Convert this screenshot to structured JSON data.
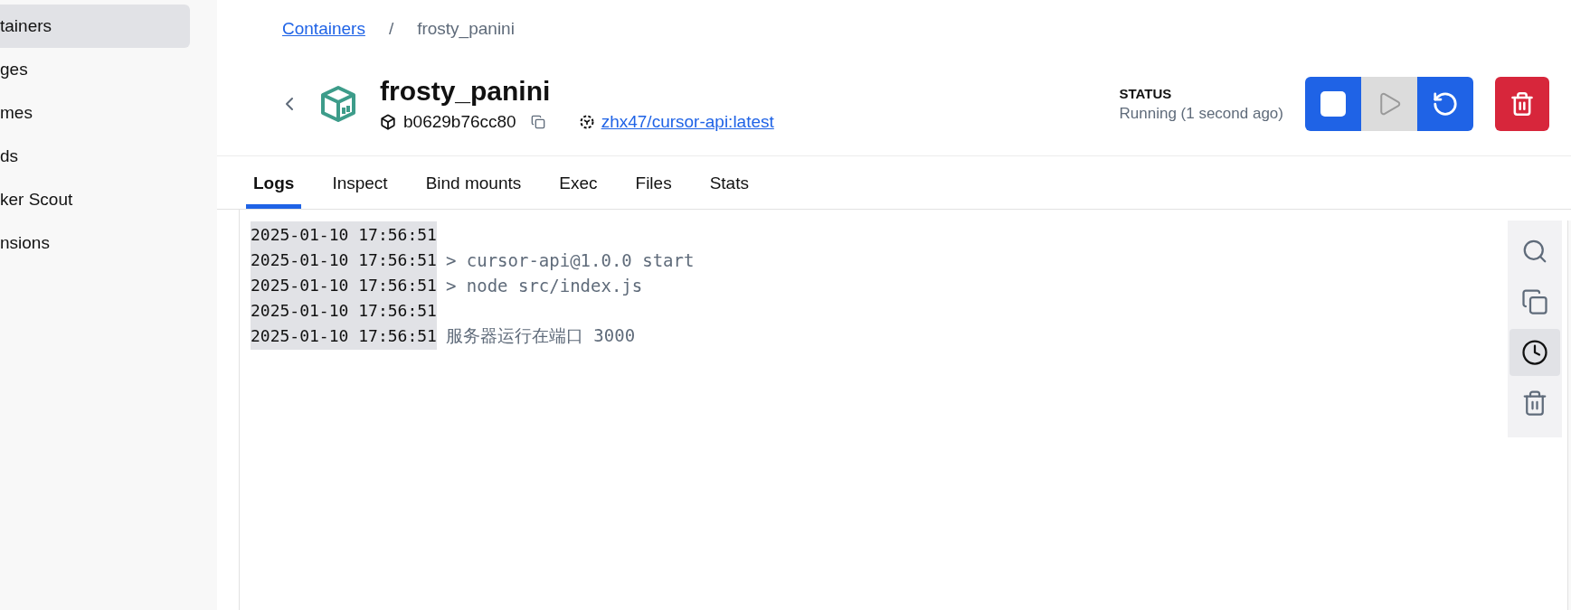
{
  "sidebar": {
    "items": [
      {
        "label": "tainers",
        "selected": true
      },
      {
        "label": "ges",
        "selected": false
      },
      {
        "label": "mes",
        "selected": false
      },
      {
        "label": "ds",
        "selected": false
      },
      {
        "label": "ker Scout",
        "selected": false
      },
      {
        "label": "nsions",
        "selected": false
      }
    ]
  },
  "breadcrumb": {
    "link": "Containers",
    "separator": "/",
    "current": "frosty_panini"
  },
  "container": {
    "name": "frosty_panini",
    "id": "b0629b76cc80",
    "image": "zhx47/cursor-api:latest"
  },
  "status": {
    "label": "STATUS",
    "value": "Running (1 second ago)"
  },
  "actions": [
    {
      "kind": "stop",
      "disabled": false
    },
    {
      "kind": "start",
      "disabled": true
    },
    {
      "kind": "restart",
      "disabled": false
    },
    {
      "kind": "delete",
      "disabled": false
    }
  ],
  "tabs": [
    {
      "label": "Logs",
      "selected": true
    },
    {
      "label": "Inspect",
      "selected": false
    },
    {
      "label": "Bind mounts",
      "selected": false
    },
    {
      "label": "Exec",
      "selected": false
    },
    {
      "label": "Files",
      "selected": false
    },
    {
      "label": "Stats",
      "selected": false
    }
  ],
  "logs": [
    {
      "timestamp": "2025-01-10 17:56:51"
    },
    {
      "timestamp": "2025-01-10 17:56:51",
      "message": "> cursor-api@1.0.0 start"
    },
    {
      "timestamp": "2025-01-10 17:56:51",
      "message": "> node src/index.js"
    },
    {
      "timestamp": "2025-01-10 17:56:51"
    },
    {
      "timestamp": "2025-01-10 17:56:51",
      "message": "服务器运行在端口 3000"
    }
  ],
  "log_tools": [
    {
      "kind": "search",
      "selected": false
    },
    {
      "kind": "copy",
      "selected": false
    },
    {
      "kind": "timestamps",
      "selected": true
    },
    {
      "kind": "clear",
      "selected": false
    }
  ]
}
